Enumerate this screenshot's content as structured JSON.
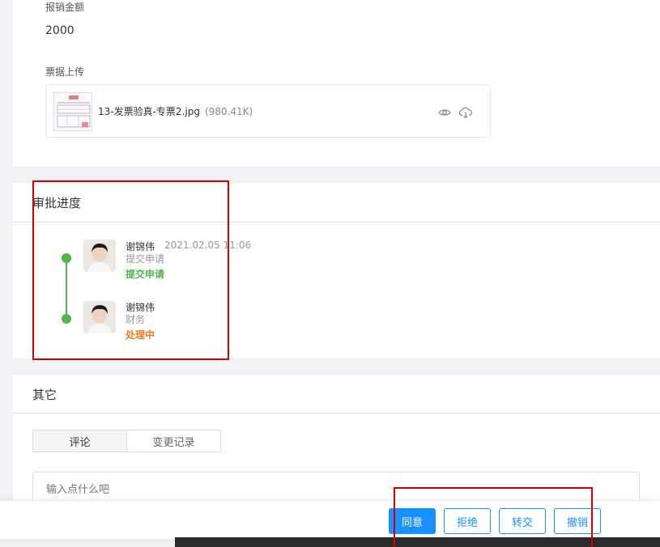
{
  "form": {
    "amount_label": "报销金额",
    "amount_value": "2000",
    "invoice_label": "票据上传",
    "attachment": {
      "file_name": "13-发票验真-专票2.jpg",
      "file_size": "(980.41K)",
      "preview_icon": "eye-icon",
      "download_icon": "cloud-download-icon"
    }
  },
  "approval": {
    "title": "审批进度",
    "steps": [
      {
        "name": "谢锦伟",
        "time": "2021.02.05 11:06",
        "action": "提交申请",
        "status": "提交申请",
        "status_color": "#52b44b"
      },
      {
        "name": "谢锦伟",
        "time": "",
        "action": "财务",
        "status": "处理中",
        "status_color": "#ee7b1e"
      }
    ]
  },
  "other": {
    "title": "其它",
    "tabs": [
      {
        "label": "评论",
        "active": true
      },
      {
        "label": "变更记录",
        "active": false
      }
    ],
    "comment_placeholder": "输入点什么吧"
  },
  "actions": {
    "agree": "同意",
    "reject": "拒绝",
    "transfer": "转交",
    "revoke": "撤销"
  },
  "colors": {
    "primary": "#1890ff",
    "success": "#52b44b",
    "processing": "#ee7b1e",
    "highlight": "#d40000"
  }
}
